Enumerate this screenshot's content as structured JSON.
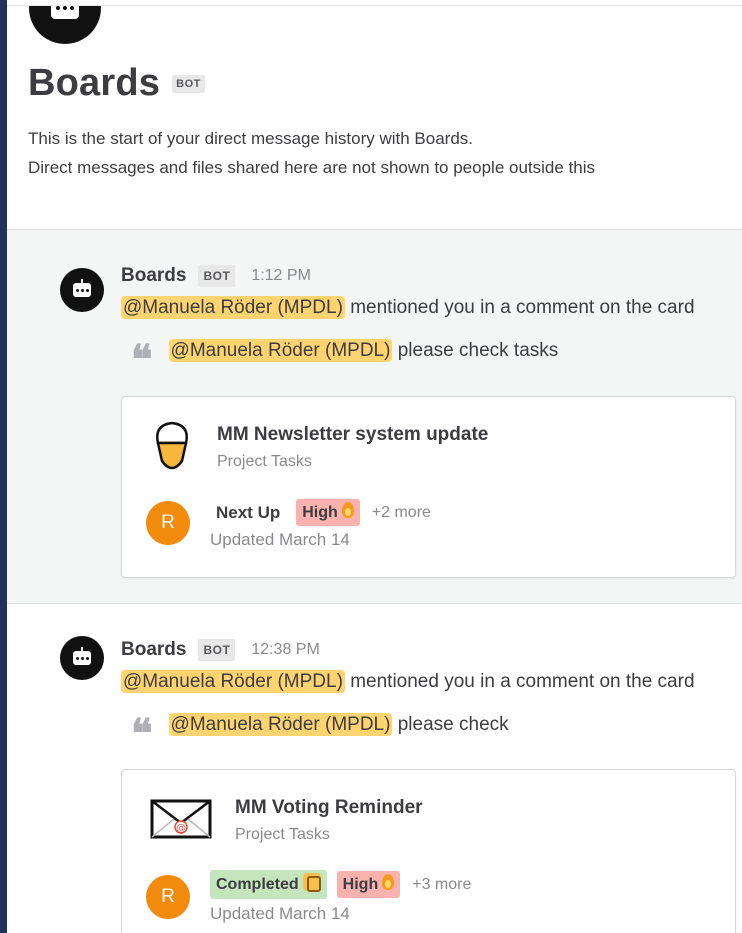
{
  "intro": {
    "title": "Boards",
    "badge": "BOT",
    "line1": "This is the start of your direct message history with Boards.",
    "line2": "Direct messages and files shared here are not shown to people outside this"
  },
  "posts": [
    {
      "author": "Boards",
      "badge": "BOT",
      "time": "1:12 PM",
      "mention": "@Manuela Röder (MPDL)",
      "message_rest": " mentioned you in a comment on the card",
      "quote_mention": "@Manuela Röder (MPDL)",
      "quote_rest": " please check tasks",
      "card": {
        "icon": "ice-cream-icon",
        "title": "MM Newsletter system update",
        "subtitle": "Project Tasks",
        "avatar_letter": "R",
        "status": "Next Up",
        "priority": "High",
        "more": "+2 more",
        "updated": "Updated March 14"
      }
    },
    {
      "author": "Boards",
      "badge": "BOT",
      "time": "12:38 PM",
      "mention": "@Manuela Röder (MPDL)",
      "message_rest": " mentioned you in a comment on the card",
      "quote_mention": "@Manuela Röder (MPDL)",
      "quote_rest": " please check",
      "card": {
        "icon": "envelope-icon",
        "title": "MM Voting Reminder",
        "subtitle": "Project Tasks",
        "avatar_letter": "R",
        "status": "Completed",
        "priority": "High",
        "more": "+3 more",
        "updated": "Updated March 14"
      }
    }
  ],
  "colors": {
    "mention_highlight": "#ffd470",
    "priority_high": "#f9b2ad",
    "status_completed": "#c5e6bd",
    "avatar_orange": "#f28b0c",
    "sidebar_edge": "#1e325c"
  }
}
